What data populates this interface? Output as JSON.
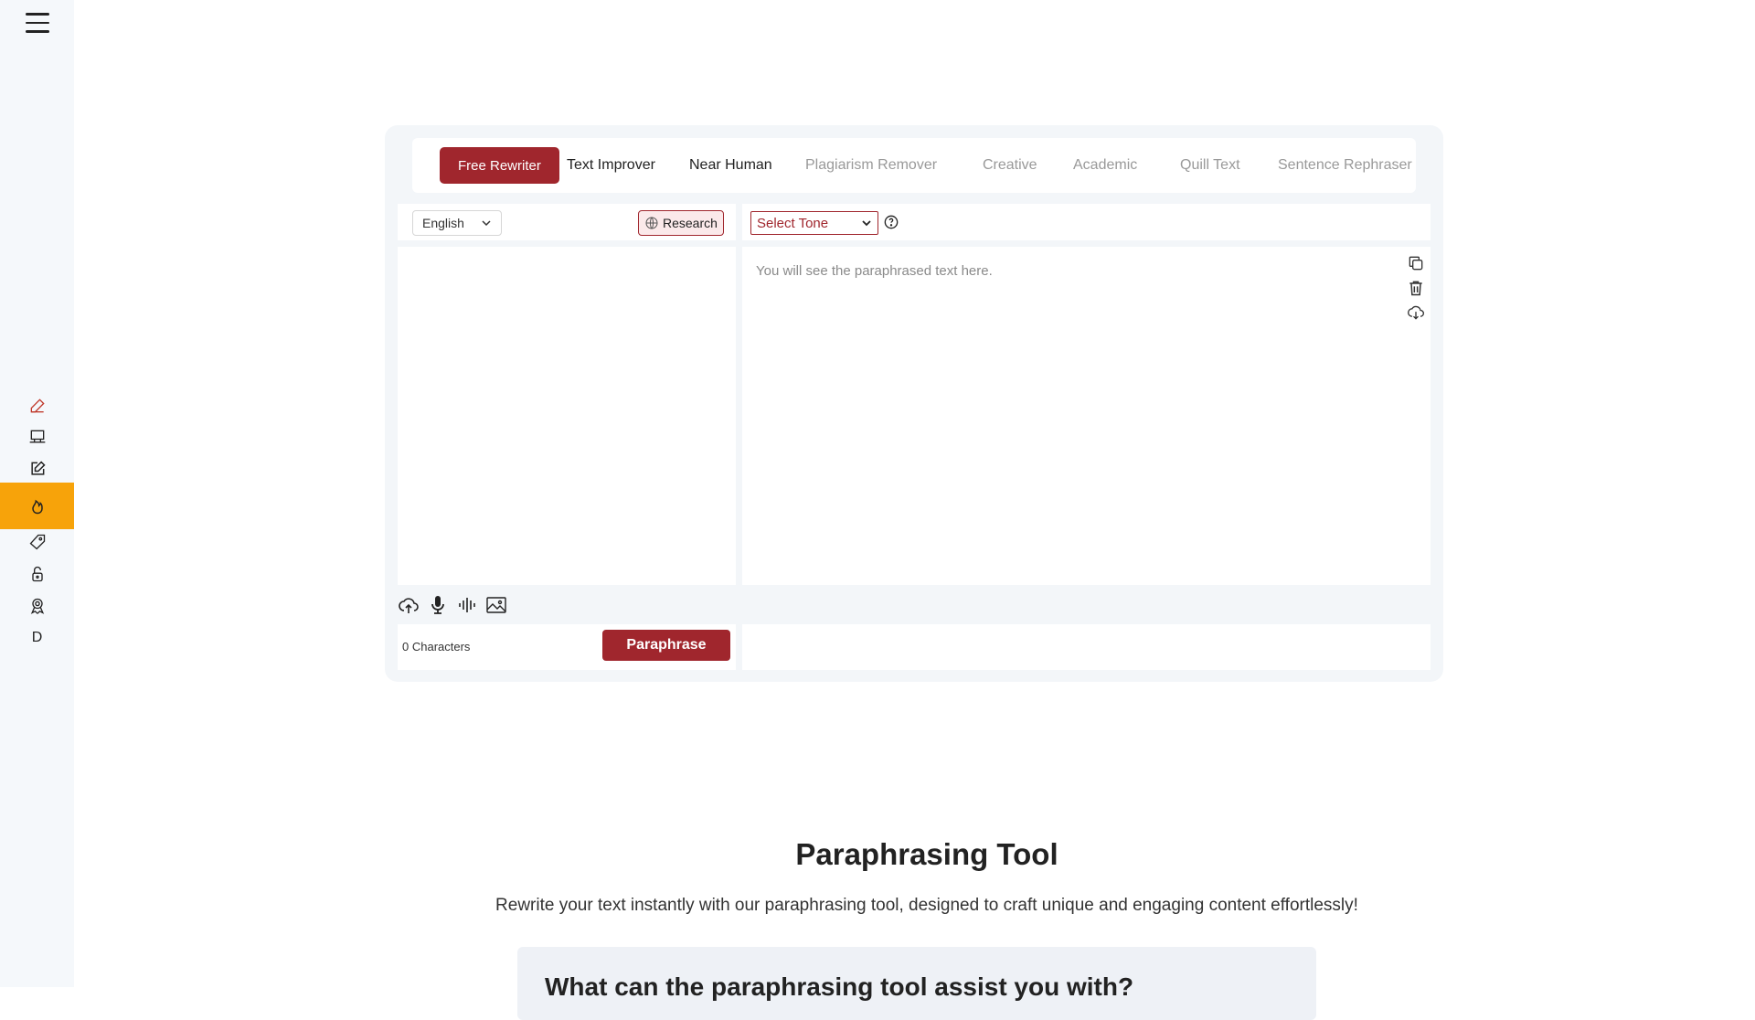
{
  "sidebar": {
    "icons": [
      "pencil-icon",
      "laptop-icon",
      "edit-icon",
      "fire-icon",
      "tag-icon",
      "lock-icon",
      "award-icon"
    ],
    "letter": "D",
    "active_color": "#f7a30a"
  },
  "tabs": [
    {
      "label": "Free Rewriter",
      "active": true
    },
    {
      "label": "Text Improver"
    },
    {
      "label": "Near Human"
    },
    {
      "label": "Plagiarism Remover"
    },
    {
      "label": "Creative"
    },
    {
      "label": "Academic"
    },
    {
      "label": "Quill Text"
    },
    {
      "label": "Sentence Rephraser"
    }
  ],
  "input_panel": {
    "language": "English",
    "research_label": "Research",
    "char_count": "0 Characters",
    "paraphrase_label": "Paraphrase"
  },
  "output_panel": {
    "tone_label": "Select Tone",
    "placeholder": "You will see the paraphrased text here."
  },
  "section": {
    "title": "Paraphrasing Tool",
    "subtitle": "Rewrite your text instantly with our paraphrasing tool, designed to craft unique and engaging content effortlessly!",
    "faq_title": "What can the paraphrasing tool assist you with?"
  },
  "colors": {
    "brand": "#a0262d",
    "accent": "#f7a30a",
    "panel_bg": "#f3f6f9"
  }
}
